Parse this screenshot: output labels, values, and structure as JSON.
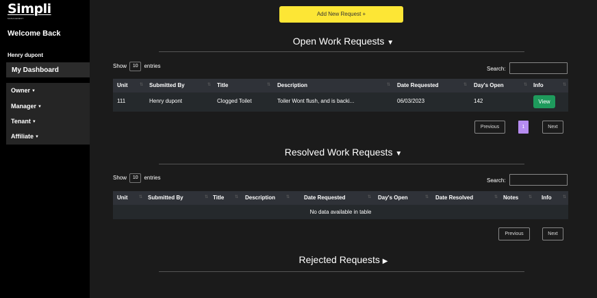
{
  "sidebar": {
    "logo": "Simpli",
    "logo_sub": "MANAGEMENT",
    "welcome": "Welcome Back",
    "username": "Henry dupont",
    "dashboard": "My Dashboard",
    "menu": [
      {
        "label": "Owner"
      },
      {
        "label": "Manager"
      },
      {
        "label": "Tenant"
      },
      {
        "label": "Affiliate"
      }
    ]
  },
  "main": {
    "add_button": "Add New Request +",
    "open": {
      "title": "Open Work Requests",
      "show_label": "Show",
      "show_value": "10",
      "entries_label": "entries",
      "search_label": "Search:",
      "columns": [
        "Unit",
        "Submitted By",
        "Title",
        "Description",
        "Date Requested",
        "Day's Open",
        "Info"
      ],
      "rows": [
        {
          "unit": "111",
          "submitted_by": "Henry dupont",
          "title": "Clogged Toilet",
          "description": "Toiler Wont flush, and is backi...",
          "date_requested": "06/03/2023",
          "days_open": "142",
          "action": "View"
        }
      ],
      "pagination": {
        "previous": "Previous",
        "page": "1",
        "next": "Next"
      }
    },
    "resolved": {
      "title": "Resolved Work Requests",
      "show_label": "Show",
      "show_value": "10",
      "entries_label": "entries",
      "search_label": "Search:",
      "columns": [
        "Unit",
        "Submitted By",
        "Title",
        "Description",
        "Date Requested",
        "Day's Open",
        "Date Resolved",
        "Notes",
        "Info"
      ],
      "empty_message": "No data available in table",
      "pagination": {
        "previous": "Previous",
        "next": "Next"
      }
    },
    "rejected": {
      "title": "Rejected Requests"
    }
  },
  "colors": {
    "sidebar_bg": "#000000",
    "main_bg": "#1b1b1b",
    "add_button": "#fde635",
    "view_button": "#1e9a5c",
    "active_page": "#b68cf0"
  },
  "icons": {
    "open_toggle": "caret-down-icon",
    "resolved_toggle": "caret-down-icon",
    "rejected_toggle": "caret-right-icon"
  }
}
